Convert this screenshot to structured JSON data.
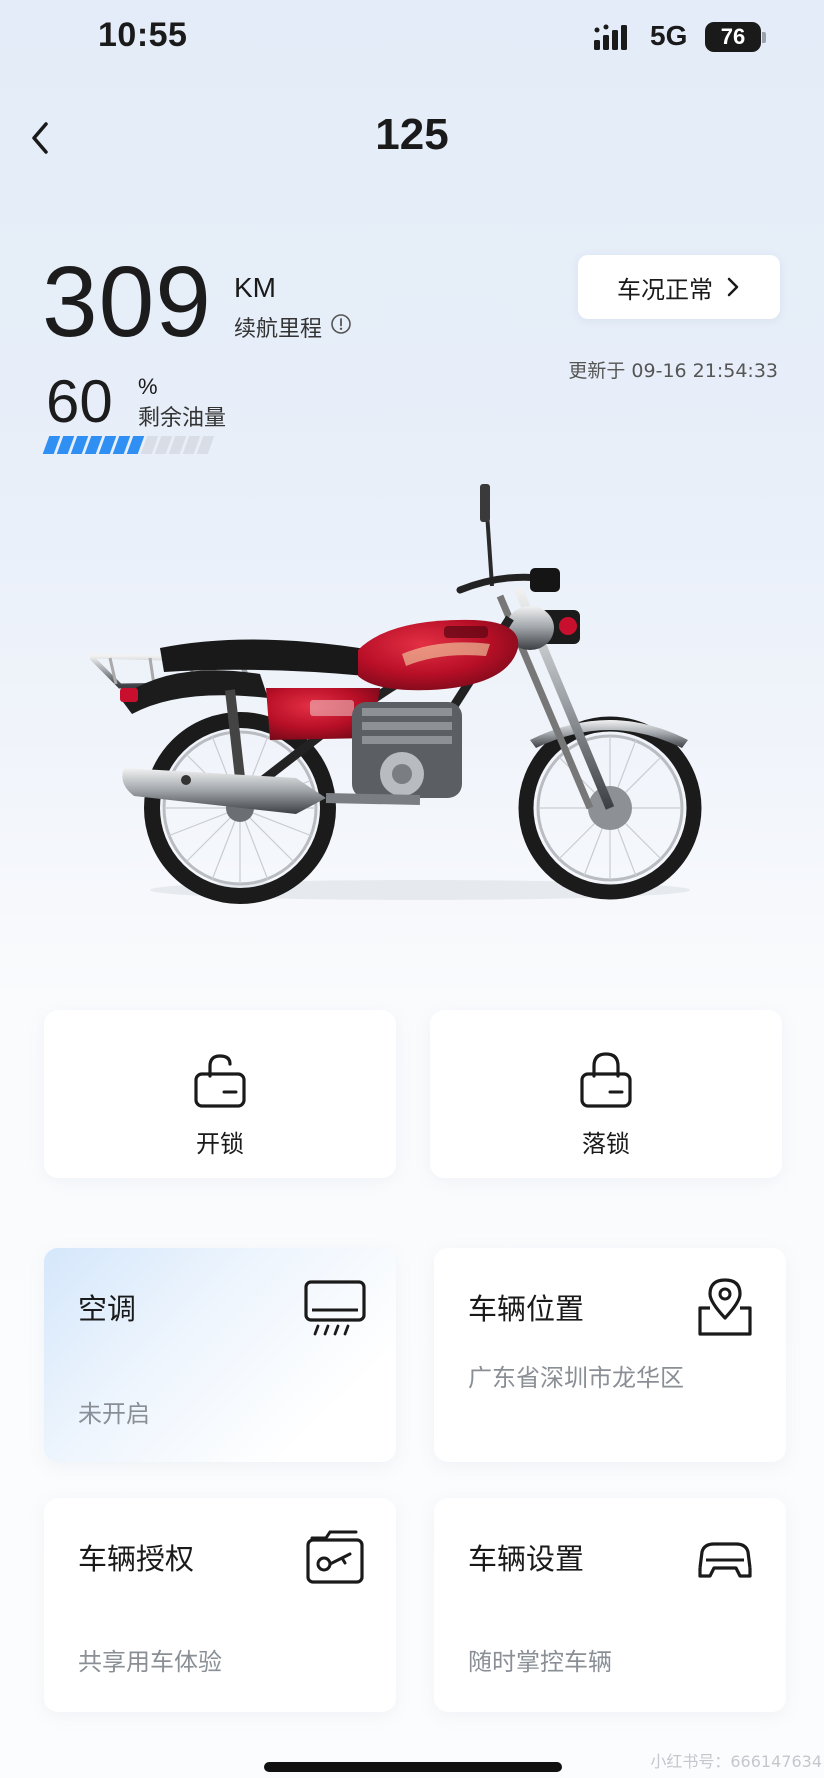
{
  "status_bar": {
    "time": "10:55",
    "network": "5G",
    "battery": "76"
  },
  "header": {
    "title": "125"
  },
  "range": {
    "value": "309",
    "unit": "KM",
    "label": "续航里程"
  },
  "fuel": {
    "value": "60",
    "unit": "%",
    "label": "剩余油量",
    "level_percent": 60,
    "segments_total": 12,
    "segments_on": 7
  },
  "vehicle_status": {
    "label": "车况正常",
    "updated": "更新于 09-16 21:54:33"
  },
  "locks": [
    {
      "label": "开锁",
      "icon": "unlock-icon"
    },
    {
      "label": "落锁",
      "icon": "lock-icon"
    }
  ],
  "features": {
    "ac": {
      "title": "空调",
      "subtitle": "未开启",
      "icon": "air-conditioner-icon"
    },
    "location": {
      "title": "车辆位置",
      "subtitle": "广东省深圳市龙华区",
      "icon": "location-map-icon"
    },
    "authorize": {
      "title": "车辆授权",
      "subtitle": "共享用车体验",
      "icon": "key-icon"
    },
    "settings": {
      "title": "车辆设置",
      "subtitle": "随时掌控车辆",
      "icon": "car-settings-icon"
    }
  },
  "watermark": "小红书号：666147634",
  "colors": {
    "accent": "#2f8ff2",
    "muted": "#8a8f96",
    "bike_red": "#c8102e"
  }
}
